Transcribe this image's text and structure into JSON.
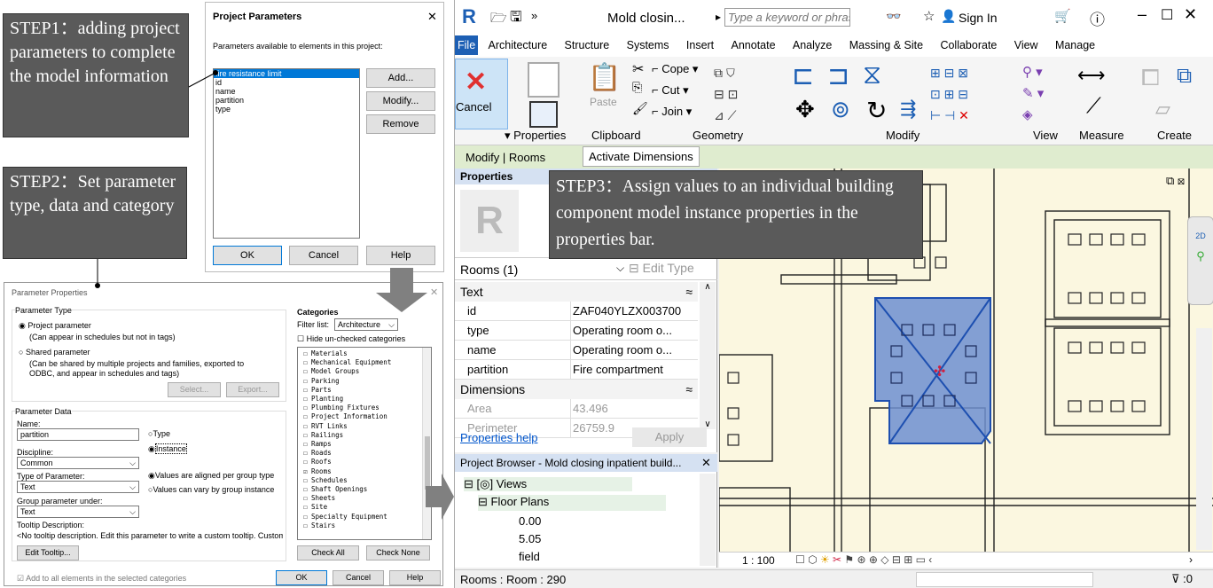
{
  "callouts": {
    "step1": "STEP1：adding project parameters to complete the model information",
    "step2": "STEP2：Set parameter type, data and category",
    "step3": "STEP3：Assign values to an individual building component model instance properties in the properties bar."
  },
  "project_params": {
    "title": "Project Parameters",
    "close": "✕",
    "subtitle": "Parameters available to elements in this project:",
    "items": [
      "fire resistance limit",
      "id",
      "name",
      "partition",
      "type"
    ],
    "add": "Add...",
    "modify": "Modify...",
    "remove": "Remove",
    "ok": "OK",
    "cancel": "Cancel",
    "help": "Help"
  },
  "param_props": {
    "title": "Parameter Properties",
    "close": "✕",
    "type_group": "Parameter Type",
    "project_param": "Project parameter",
    "project_param_note": "(Can appear in schedules but not in tags)",
    "shared_param": "Shared parameter",
    "shared_param_note": "(Can be shared by multiple projects and families, exported to ODBC, and appear in schedules and tags)",
    "select": "Select...",
    "export": "Export...",
    "data_group": "Parameter Data",
    "name_label": "Name:",
    "name_value": "partition",
    "type_radio": "Type",
    "instance_radio": "Instance",
    "discipline_label": "Discipline:",
    "discipline_value": "Common",
    "type_of_param_label": "Type of Parameter:",
    "type_of_param_value": "Text",
    "aligned": "Values are aligned per group type",
    "vary": "Values can vary by group instance",
    "group_label": "Group parameter under:",
    "group_value": "Text",
    "tooltip_label": "Tooltip Description:",
    "tooltip_value": "<No tooltip description. Edit this parameter to write a custom tooltip. Custom tooltips hav...",
    "edit_tooltip": "Edit Tooltip...",
    "add_all": "Add to all elements in the selected categories",
    "categories_label": "Categories",
    "filter_label": "Filter list:",
    "filter_value": "Architecture",
    "hide_unchecked": "Hide un-checked categories",
    "categories": [
      {
        "name": "Materials",
        "checked": false
      },
      {
        "name": "Mechanical Equipment",
        "checked": false
      },
      {
        "name": "Model Groups",
        "checked": false
      },
      {
        "name": "Parking",
        "checked": false
      },
      {
        "name": "Parts",
        "checked": false
      },
      {
        "name": "Planting",
        "checked": false
      },
      {
        "name": "Plumbing Fixtures",
        "checked": false
      },
      {
        "name": "Project Information",
        "checked": false
      },
      {
        "name": "RVT Links",
        "checked": false
      },
      {
        "name": "Railings",
        "checked": false
      },
      {
        "name": "Ramps",
        "checked": false
      },
      {
        "name": "Roads",
        "checked": false
      },
      {
        "name": "Roofs",
        "checked": false
      },
      {
        "name": "Rooms",
        "checked": true
      },
      {
        "name": "Schedules",
        "checked": false
      },
      {
        "name": "Shaft Openings",
        "checked": false
      },
      {
        "name": "Sheets",
        "checked": false
      },
      {
        "name": "Site",
        "checked": false
      },
      {
        "name": "Specialty Equipment",
        "checked": false
      },
      {
        "name": "Stairs",
        "checked": false
      }
    ],
    "check_all": "Check All",
    "check_none": "Check None",
    "ok": "OK",
    "cancel": "Cancel",
    "help": "Help"
  },
  "revit": {
    "logo": "R",
    "title": "Mold closin...",
    "search_placeholder": "Type a keyword or phrase",
    "sign_in": "Sign In",
    "tabs": [
      "File",
      "Architecture",
      "Structure",
      "Systems",
      "Insert",
      "Annotate",
      "Analyze",
      "Massing & Site",
      "Collaborate",
      "View",
      "Manage"
    ],
    "cancel_label": "Cancel",
    "properties_btn": "Properties",
    "cope": "Cope",
    "cut": "Cut",
    "join": "Join",
    "paste": "Paste",
    "panels": [
      "Properties",
      "Clipboard",
      "Geometry",
      "Modify",
      "View",
      "Measure",
      "Create"
    ],
    "context_tab": "Modify | Rooms",
    "activate_dims": "Activate Dimensions",
    "properties_title": "Properties",
    "type_selector": "Rooms (1)",
    "edit_type": "Edit Type",
    "section_text": "Text",
    "section_dimensions": "Dimensions",
    "rows": [
      {
        "name": "id",
        "value": "ZAF040YLZX003700"
      },
      {
        "name": "type",
        "value": "Operating room o..."
      },
      {
        "name": "name",
        "value": "Operating room o..."
      },
      {
        "name": "partition",
        "value": "Fire compartment"
      }
    ],
    "dim_rows": [
      {
        "name": "Area",
        "value": "43.496"
      },
      {
        "name": "Perimeter",
        "value": "26759.9"
      }
    ],
    "properties_help": "Properties help",
    "apply": "Apply",
    "browser_title": "Project Browser - Mold closing inpatient build...",
    "browser_views": "Views",
    "browser_floor_plans": "Floor Plans",
    "browser_items": [
      "0.00",
      "5.05",
      "field"
    ],
    "scale": "1 : 100",
    "status": "Rooms : Room : 290",
    "status_right": ":0",
    "nav_2d": "2D"
  }
}
